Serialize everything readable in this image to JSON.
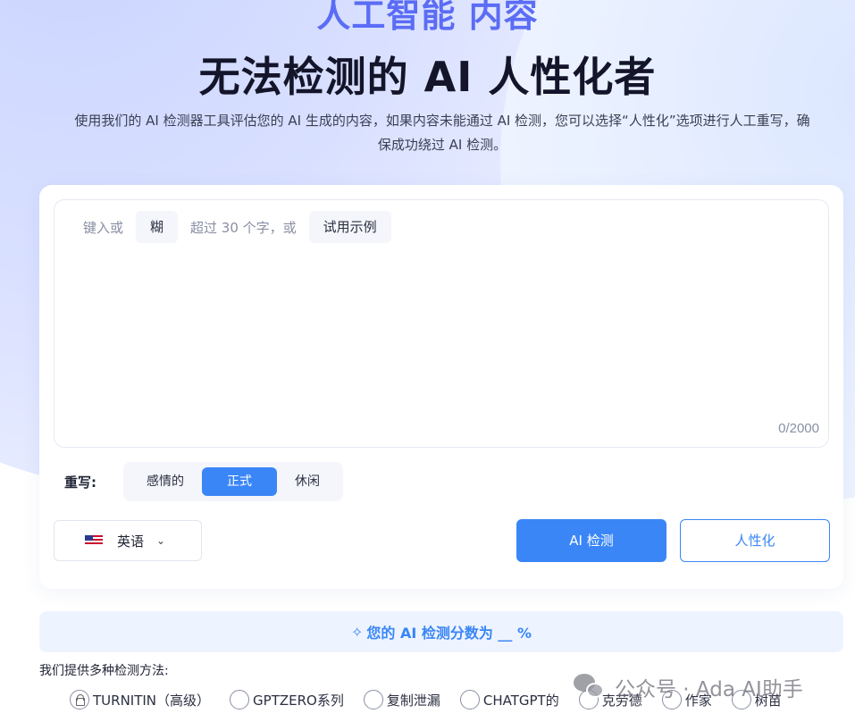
{
  "hero": {
    "top_line": "人工智能 内容",
    "title": "无法检测的 AI 人性化者",
    "description": "使用我们的 AI 检测器工具评估您的 AI 生成的内容，如果内容未能通过 AI 检测，您可以选择“人性化”选项进行人工重写，确保成功绕过 AI 检测。"
  },
  "editor": {
    "hint_prefix": "键入或",
    "paste_chip": "糊",
    "hint_middle": "超过 30 个字，或",
    "sample_chip": "试用示例",
    "counter": "0/2000"
  },
  "rewrite": {
    "label": "重写:",
    "tones": [
      {
        "label": "感情的",
        "active": false
      },
      {
        "label": "正式",
        "active": true
      },
      {
        "label": "休闲",
        "active": false
      }
    ]
  },
  "language": {
    "selected": "英语",
    "flag_icon": "us-flag-icon"
  },
  "actions": {
    "detect_label": "AI 检测",
    "humanize_label": "人性化"
  },
  "score": {
    "text": "您的 AI 检测分数为 __ %"
  },
  "methods": {
    "title": "我们提供多种检测方法:",
    "items": [
      {
        "label": "TURNITIN（高级）",
        "locked": true
      },
      {
        "label": "GPTZERO系列",
        "locked": false
      },
      {
        "label": "复制泄漏",
        "locked": false
      },
      {
        "label": "CHATGPT的",
        "locked": false
      },
      {
        "label": "克劳德",
        "locked": false
      },
      {
        "label": "作家",
        "locked": false
      },
      {
        "label": "树苗",
        "locked": false
      }
    ]
  },
  "watermark": {
    "text": "公众号 · Ada AI助手"
  },
  "colors": {
    "accent": "#3a86f7",
    "hero_top": "#5b6cf5",
    "title": "#14152a"
  }
}
